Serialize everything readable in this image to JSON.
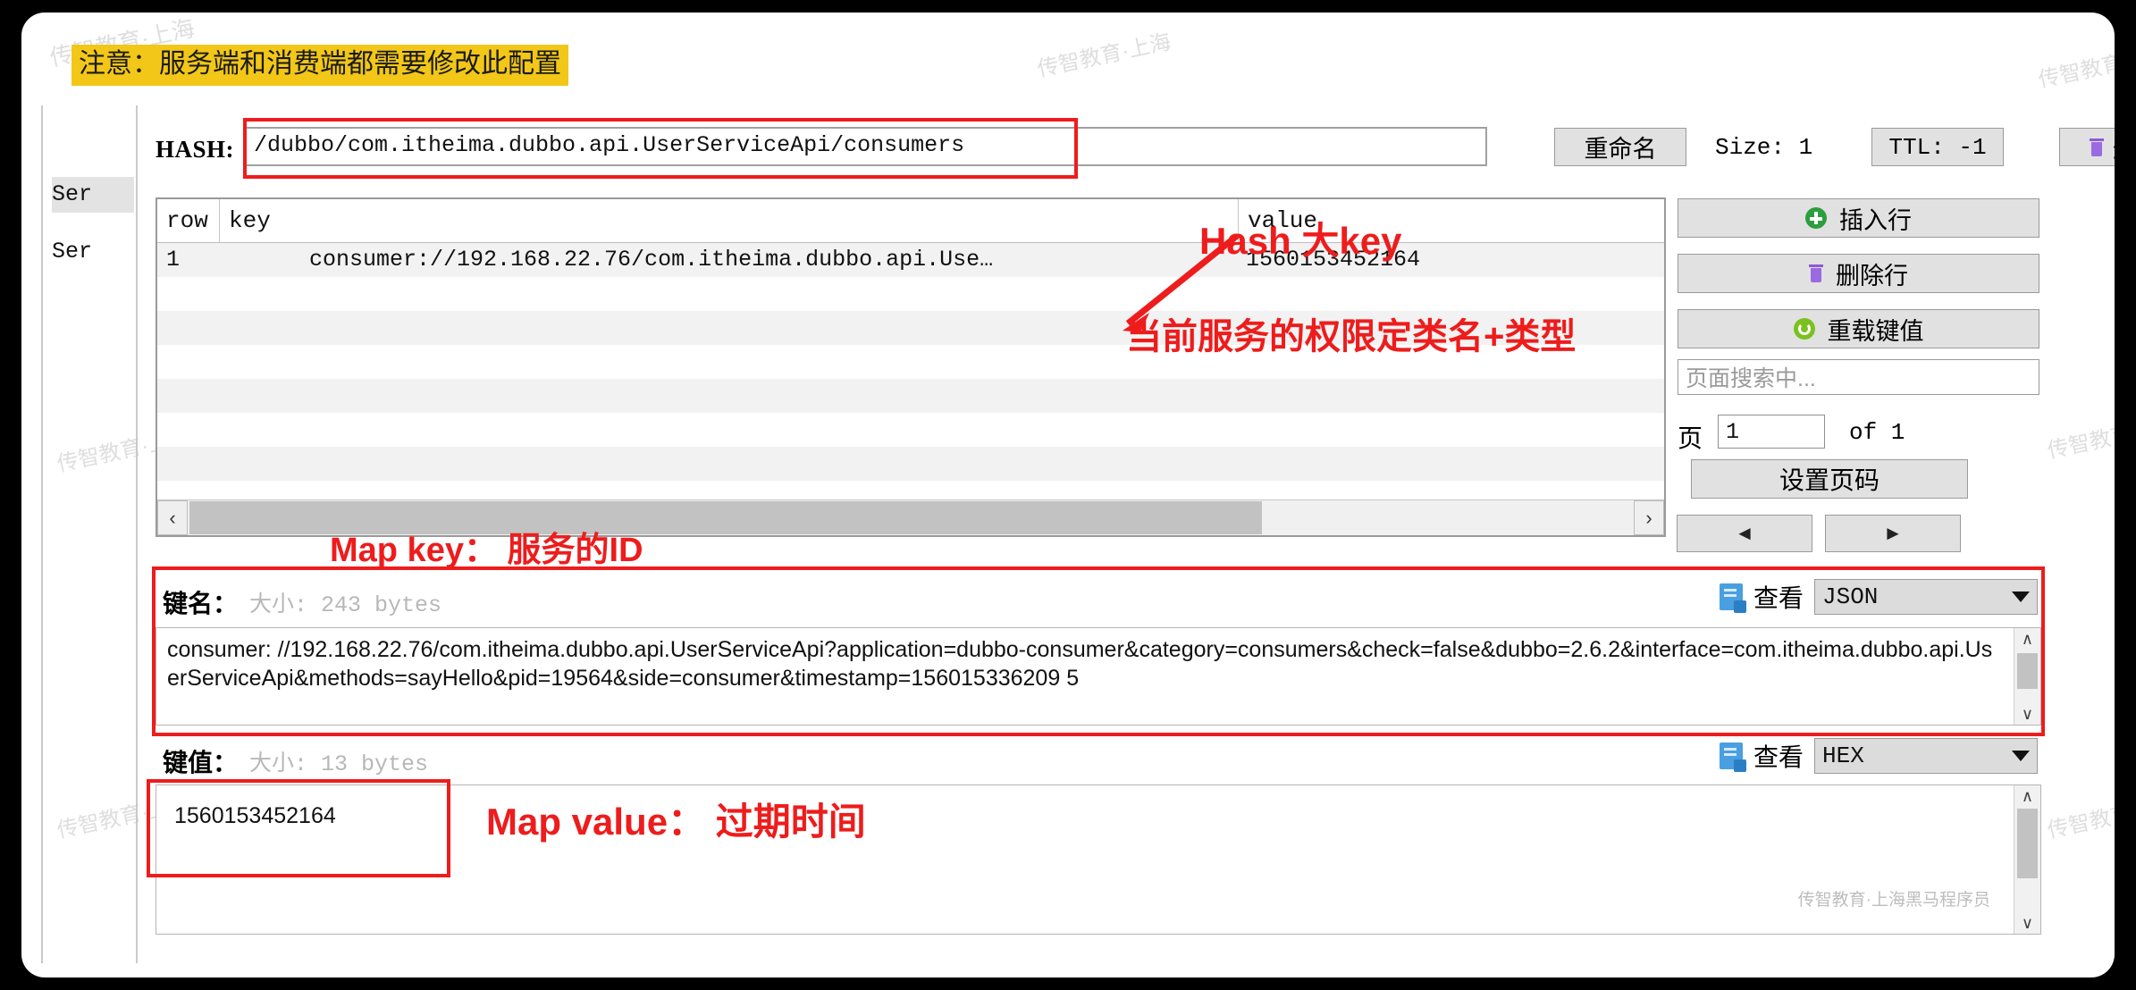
{
  "note": {
    "text": "注意：服务端和消费端都需要修改此配置",
    "bg": "#f2c717"
  },
  "tree": {
    "item1": "Ser",
    "item2": "Ser"
  },
  "hash_bar": {
    "label": "HASH:",
    "value": "/dubbo/com.itheima.dubbo.api.UserServiceApi/consumers",
    "rename_label": "重命名",
    "size_label": "Size: 1",
    "ttl_label": "TTL: -1",
    "delete_label": "删除"
  },
  "table": {
    "columns": [
      "row",
      "key",
      "value"
    ],
    "rows": [
      {
        "row": "1",
        "key": "consumer://192.168.22.76/com.itheima.dubbo.api.Use…",
        "value": "1560153452164"
      }
    ]
  },
  "side_actions": {
    "insert_row": "插入行",
    "delete_row": "删除行",
    "reload_values": "重载键值",
    "search_placeholder": "页面搜索中...",
    "page_label": "页",
    "page_value": "1",
    "page_of": "of 1",
    "set_page": "设置页码",
    "prev": "◄",
    "next": "►"
  },
  "key_section": {
    "label": "键名：",
    "size": "大小: 243 bytes",
    "view_label": "查看",
    "view_format": "JSON",
    "content": "consumer: //192.168.22.76/com.itheima.dubbo.api.UserServiceApi?application=dubbo-consumer&category=consumers&check=false&dubbo=2.6.2&interface=com.itheima.dubbo.api.UserServiceApi&methods=sayHello&pid=19564&side=consumer&timestamp=156015336209 5"
  },
  "value_section": {
    "label": "键值：",
    "size": "大小: 13 bytes",
    "view_label": "查看",
    "view_format": "HEX",
    "content": "1560153452164"
  },
  "annotations": {
    "hash_big_key": "Hash  大key",
    "fqcn_type": "当前服务的权限定类名+类型",
    "map_key": "Map key：  服务的ID",
    "map_value": "Map value： 过期时间",
    "color": "#ee1c1c"
  },
  "watermarks": {
    "bg": "传智教育·上海",
    "footer": "传智教育·上海黑马程序员"
  }
}
